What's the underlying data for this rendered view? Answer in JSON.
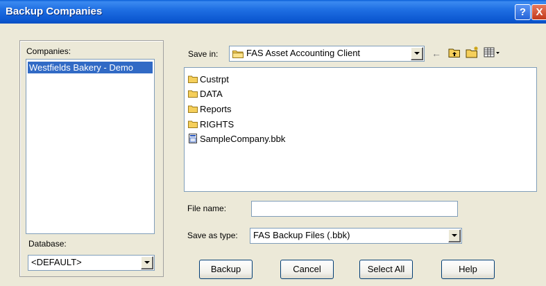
{
  "window": {
    "title": "Backup Companies",
    "help_button": "?",
    "close_button": "X"
  },
  "companies": {
    "label": "Companies:",
    "items": [
      "Westfields Bakery - Demo"
    ]
  },
  "database": {
    "label": "Database:",
    "value": "<DEFAULT>"
  },
  "save_in": {
    "label": "Save in:",
    "value": "FAS Asset Accounting Client"
  },
  "toolbar": {
    "back_icon": "back-arrow-icon",
    "up_icon": "up-folder-icon",
    "new_folder_icon": "new-folder-icon",
    "view_icon": "view-menu-icon"
  },
  "files": [
    {
      "name": "Custrpt",
      "type": "folder"
    },
    {
      "name": "DATA",
      "type": "folder"
    },
    {
      "name": "Reports",
      "type": "folder"
    },
    {
      "name": "RIGHTS",
      "type": "folder"
    },
    {
      "name": "SampleCompany.bbk",
      "type": "file"
    }
  ],
  "file_name": {
    "label": "File name:",
    "value": ""
  },
  "save_as_type": {
    "label": "Save as type:",
    "value": "FAS Backup Files (.bbk)"
  },
  "buttons": {
    "backup": "Backup",
    "cancel": "Cancel",
    "select_all": "Select All",
    "help": "Help"
  },
  "colors": {
    "title_bar": "#0c58d1",
    "selection": "#316ac5",
    "dialog_bg": "#ece9d8",
    "folder": "#f5cf5b"
  }
}
